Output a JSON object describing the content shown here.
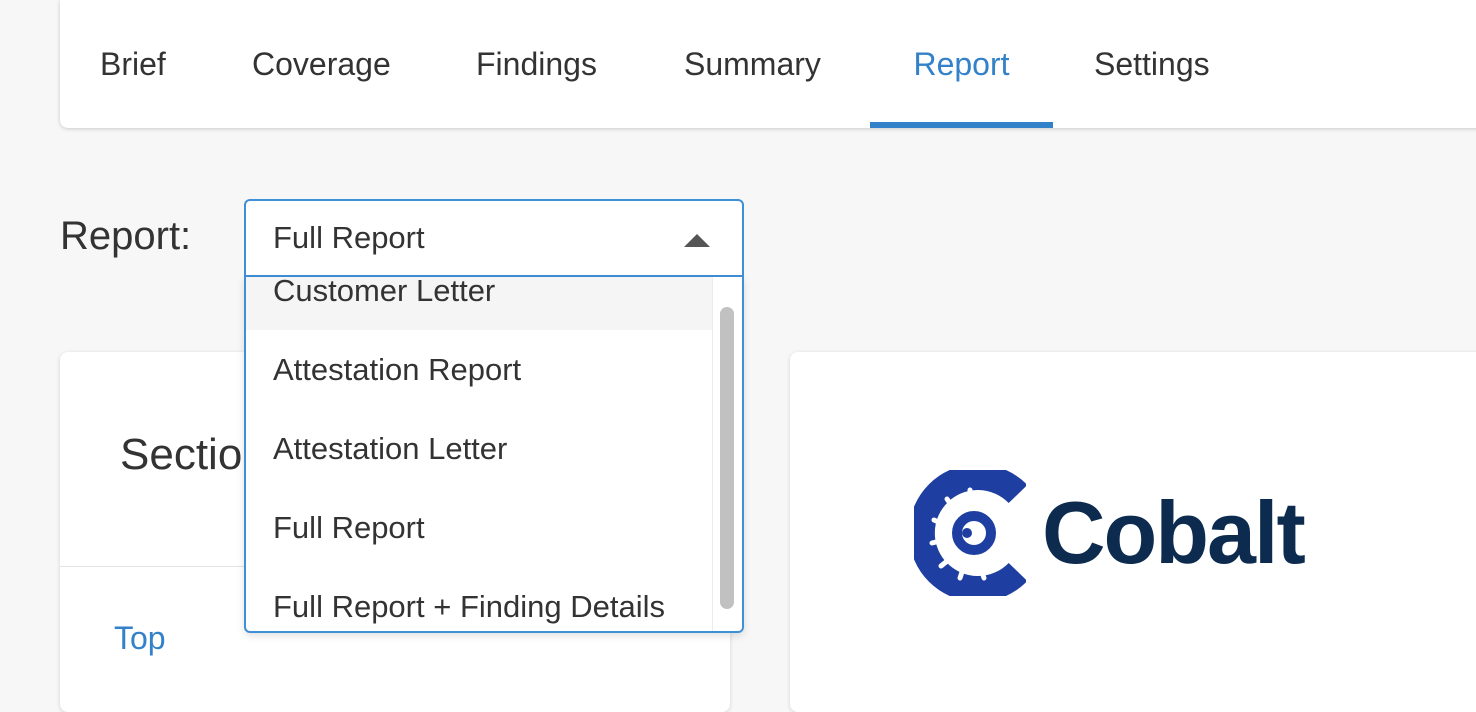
{
  "tabs": [
    {
      "label": "Brief",
      "active": false
    },
    {
      "label": "Coverage",
      "active": false
    },
    {
      "label": "Findings",
      "active": false
    },
    {
      "label": "Summary",
      "active": false
    },
    {
      "label": "Report",
      "active": true
    },
    {
      "label": "Settings",
      "active": false
    }
  ],
  "report_select": {
    "label": "Report:",
    "selected": "Full Report",
    "options": [
      "Customer Letter",
      "Attestation Report",
      "Attestation Letter",
      "Full Report",
      "Full Report + Finding Details"
    ]
  },
  "sections_card": {
    "title": "Sections",
    "top_link": "Top"
  },
  "logo": {
    "text": "Cobalt",
    "color": "#0d2a4f",
    "mark_color": "#1e3fa1"
  },
  "colors": {
    "accent": "#3381c9",
    "background": "#f7f7f7"
  }
}
